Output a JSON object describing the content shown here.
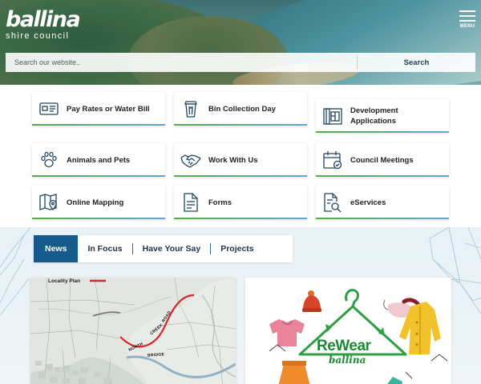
{
  "header": {
    "logo_main": "ballina",
    "logo_sub": "shire council",
    "menu_label": "MENU"
  },
  "search": {
    "placeholder": "Search our website..",
    "button_label": "Search"
  },
  "quick_links": [
    {
      "label": "Pay Rates or Water Bill",
      "icon": "bill-icon"
    },
    {
      "label": "Bin Collection Day",
      "icon": "bin-icon"
    },
    {
      "label": "Development Applications",
      "icon": "blueprint-icon"
    },
    {
      "label": "Animals and Pets",
      "icon": "paw-icon"
    },
    {
      "label": "Work With Us",
      "icon": "handshake-icon"
    },
    {
      "label": "Council Meetings",
      "icon": "calendar-icon"
    },
    {
      "label": "Online Mapping",
      "icon": "map-icon"
    },
    {
      "label": "Forms",
      "icon": "document-icon"
    },
    {
      "label": "eServices",
      "icon": "search-document-icon"
    }
  ],
  "news": {
    "tabs": [
      "News",
      "In Focus",
      "Have Your Say",
      "Projects"
    ],
    "active_tab": "News",
    "map_card": {
      "legend_label": "Locality Plan",
      "road_labels": [
        "NORTH",
        "CREEK",
        "ROAD",
        "BRIDGE"
      ]
    },
    "rewear_card": {
      "title": "ReWear",
      "subtitle": "ballina"
    }
  },
  "colors": {
    "accent_blue": "#145a8a",
    "accent_green": "#5ea84c",
    "rewear_green": "#1c8a32",
    "road_red": "#d9232d"
  }
}
